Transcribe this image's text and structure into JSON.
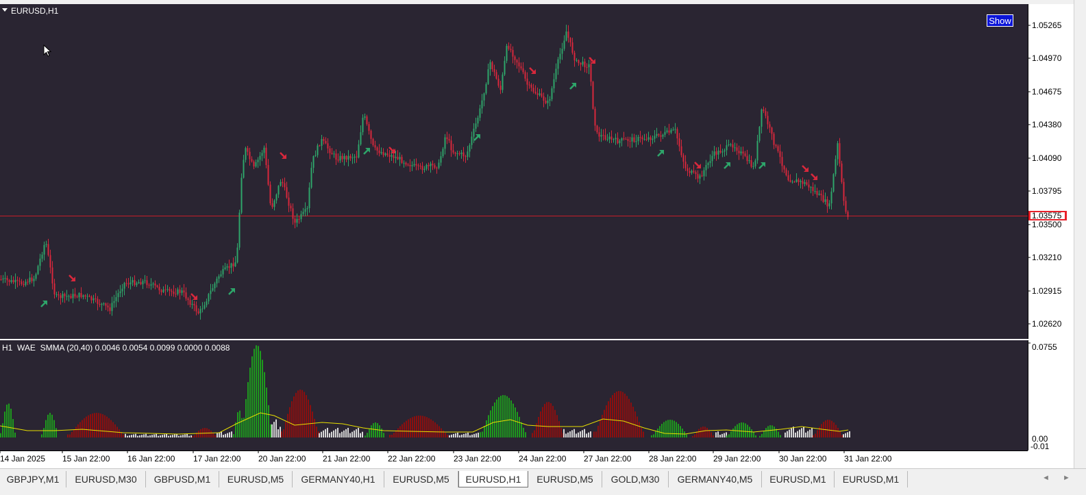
{
  "chart": {
    "title": "EURUSD,H1",
    "show_button": "Show",
    "price_labels": [
      "1.05265",
      "1.04970",
      "1.04675",
      "1.04380",
      "1.04090",
      "1.03795",
      "1.03500",
      "1.03210",
      "1.02915",
      "1.02620"
    ],
    "current_price": "1.03575",
    "current_price_color": "#e8202a",
    "bull_color": "#2ea56a",
    "bear_color": "#d8283c"
  },
  "indicator": {
    "title": "H1  WAE  SMMA (20,40) 0.0046 0.0054 0.0099 0.0000 0.0088",
    "axis_labels": [
      "0.0755",
      "0.00",
      "-0.01"
    ],
    "up_color": "#1e9a1e",
    "down_color": "#8c0f0f",
    "neutral_color": "#d8d8d8",
    "line_color": "#e8e000"
  },
  "time_axis": {
    "labels": [
      "14 Jan 2025",
      "15 Jan 22:00",
      "16 Jan 22:00",
      "17 Jan 22:00",
      "20 Jan 22:00",
      "21 Jan 22:00",
      "22 Jan 22:00",
      "23 Jan 22:00",
      "24 Jan 22:00",
      "27 Jan 22:00",
      "28 Jan 22:00",
      "29 Jan 22:00",
      "30 Jan 22:00",
      "31 Jan 22:00"
    ]
  },
  "tabs": [
    {
      "label": "GBPJPY,M1",
      "active": false
    },
    {
      "label": "EURUSD,M30",
      "active": false
    },
    {
      "label": "GBPUSD,M1",
      "active": false
    },
    {
      "label": "EURUSD,M5",
      "active": false
    },
    {
      "label": "GERMANY40,H1",
      "active": false
    },
    {
      "label": "EURUSD,M5",
      "active": false
    },
    {
      "label": "EURUSD,H1",
      "active": true
    },
    {
      "label": "EURUSD,M5",
      "active": false
    },
    {
      "label": "GOLD,M30",
      "active": false
    },
    {
      "label": "GERMANY40,M5",
      "active": false
    },
    {
      "label": "EURUSD,M1",
      "active": false
    },
    {
      "label": "EURUSD,M1",
      "active": false
    }
  ],
  "icons": {
    "arrow_left": "◄",
    "arrow_right": "►",
    "buy_signal": "arrow-up-right-icon",
    "sell_signal": "arrow-down-right-icon"
  }
}
